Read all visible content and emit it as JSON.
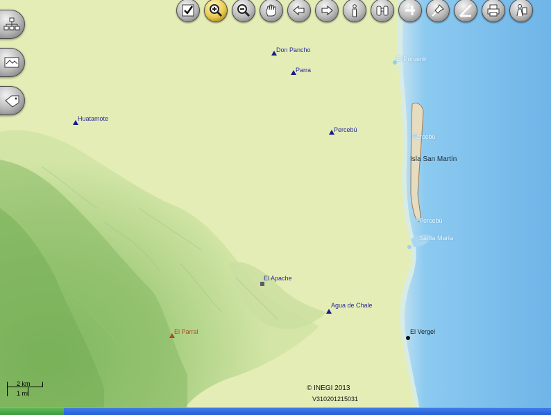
{
  "toolbar": {
    "tools": [
      {
        "name": "check-icon"
      },
      {
        "name": "zoom-in-icon",
        "active": true
      },
      {
        "name": "zoom-out-icon"
      },
      {
        "name": "pan-hand-icon"
      },
      {
        "name": "back-arrow-icon"
      },
      {
        "name": "forward-arrow-icon"
      },
      {
        "name": "info-icon"
      },
      {
        "name": "binoculars-icon"
      },
      {
        "name": "measure-icon"
      },
      {
        "name": "pin-icon"
      },
      {
        "name": "angle-tool-icon"
      },
      {
        "name": "print-icon"
      },
      {
        "name": "help-person-icon"
      }
    ]
  },
  "sidebar": {
    "buttons": [
      {
        "name": "hierarchy-icon"
      },
      {
        "name": "map-layers-icon"
      },
      {
        "name": "tag-icon"
      }
    ]
  },
  "places": {
    "don_pancho": "Don Pancho",
    "parra": "Parra",
    "huatamote": "Huatamote",
    "perebu_inland": "Percebú",
    "el_porvenir": "El Porvenir",
    "percebu_north": "Percebú",
    "isla_san_martin": "Isla San Martín",
    "percebu_south": "Percebú",
    "santa_maria": "Santa María",
    "el_apache": "El Apache",
    "agua_de_chale": "Agua de Chale",
    "el_parral": "El Parral",
    "el_vergel": "El Vergel"
  },
  "scale": {
    "km": "2 km",
    "mi": "1 mi"
  },
  "footer": {
    "copyright": "© INEGI 2013",
    "version": "V310201215031"
  },
  "colors": {
    "plain": "#e4edb6",
    "hills": "#8fbe6a",
    "sea": "#6ab3e6",
    "coast": "#dceee0",
    "toolbar_button": "#b9b9b9",
    "active_button": "#e9c94b"
  }
}
